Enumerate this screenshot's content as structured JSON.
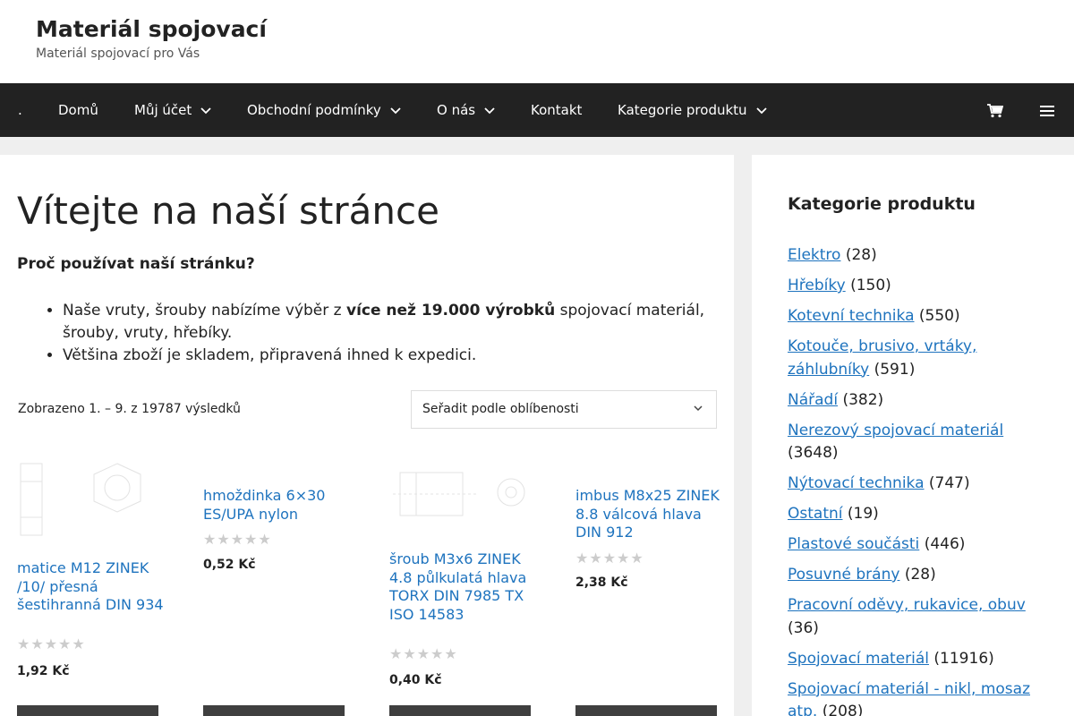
{
  "header": {
    "site_title": "Materiál spojovací",
    "tagline": "Materiál spojovací pro Vás"
  },
  "nav": {
    "items": [
      {
        "label": "."
      },
      {
        "label": "Domů"
      },
      {
        "label": "Můj účet"
      },
      {
        "label": "Obchodní podmínky"
      },
      {
        "label": "O nás"
      },
      {
        "label": "Kontakt"
      },
      {
        "label": "Kategorie produktu"
      }
    ],
    "cart_icon": "cart-icon",
    "menu_icon": "hamburger-menu-icon"
  },
  "main": {
    "page_title": "Vítejte na naší stránce",
    "intro_question": "Proč používat naší stránku?",
    "bullet1_pre": "Naše vruty, šrouby nabízíme výběr z ",
    "bullet1_bold": "více než 19.000 výrobků",
    "bullet1_post": " spojovací materiál, šrouby, vruty, hřebíky.",
    "bullet2": "Většina zboží je skladem, připravená ihned k expedici.",
    "result_count": "Zobrazeno 1. – 9. z 19787 výsledků",
    "sort_selected": "Seřadit podle oblíbenosti"
  },
  "products": [
    {
      "title": "matice M12 ZINEK /10/ přesná šestihranná DIN 934",
      "stars": "★★★★★",
      "rating": 0,
      "price": "1,92 Kč"
    },
    {
      "title": "hmoždinka 6×30 ES/UPA nylon",
      "stars": "★★★★★",
      "rating": 0,
      "price": "0,52 Kč"
    },
    {
      "title": "šroub M3x6 ZINEK 4.8 půlkulatá hlava TORX DIN 7985 TX ISO 14583",
      "stars": "★★★★★",
      "rating": 0,
      "price": "0,40 Kč"
    },
    {
      "title": "imbus M8x25 ZINEK 8.8 válcová hlava DIN 912",
      "stars": "★★★★★",
      "rating": 0,
      "price": "2,38 Kč"
    }
  ],
  "sidebar": {
    "widget_title": "Kategorie produktu",
    "categories": [
      {
        "name": "Elektro",
        "count": "(28)"
      },
      {
        "name": "Hřebíky",
        "count": "(150)"
      },
      {
        "name": "Kotevní technika",
        "count": "(550)"
      },
      {
        "name": "Kotouče, brusivo, vrtáky, záhlubníky",
        "count": "(591)"
      },
      {
        "name": "Nářadí",
        "count": "(382)"
      },
      {
        "name": "Nerezový spojovací materiál",
        "count": "(3648)"
      },
      {
        "name": "Nýtovací technika",
        "count": "(747)"
      },
      {
        "name": "Ostatní",
        "count": "(19)"
      },
      {
        "name": "Plastové součásti",
        "count": "(446)"
      },
      {
        "name": "Posuvné brány",
        "count": "(28)"
      },
      {
        "name": "Pracovní oděvy, rukavice, obuv",
        "count": "(36)"
      },
      {
        "name": "Spojovací materiál",
        "count": "(11916)"
      },
      {
        "name": "Spojovací materiál - nikl, mosaz atp.",
        "count": "(208)"
      }
    ]
  },
  "colors": {
    "nav_background": "#222222",
    "link": "#1e73be",
    "page_background": "#efefef"
  }
}
